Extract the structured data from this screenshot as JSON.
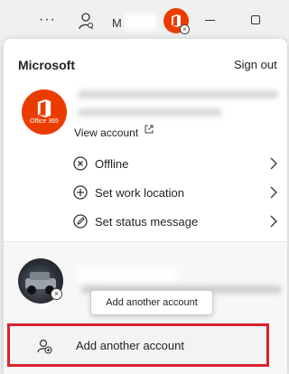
{
  "titlebar": {
    "more_label": "···",
    "name_text": "M"
  },
  "account": {
    "brand": "Microsoft",
    "sign_out": "Sign out",
    "avatar_badge_text": "Office 365",
    "view_account": "View account"
  },
  "menu": [
    {
      "label": "Offline",
      "icon": "offline-icon"
    },
    {
      "label": "Set work location",
      "icon": "work-location-icon"
    },
    {
      "label": "Set status message",
      "icon": "status-message-icon"
    }
  ],
  "other_account": {
    "tooltip": "Add another account"
  },
  "add_account": {
    "label": "Add another account",
    "icon": "add-person-icon"
  },
  "colors": {
    "office_brand": "#eb3c00",
    "highlight_border": "#d9222e"
  }
}
